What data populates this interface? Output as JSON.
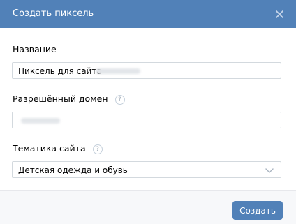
{
  "dialog": {
    "title": "Создать пиксель",
    "close_icon": "close-icon"
  },
  "form": {
    "name": {
      "label": "Название",
      "value_prefix": "Пиксель для сайта"
    },
    "domain": {
      "label": "Разрешённый домен",
      "help_icon": "?"
    },
    "topic": {
      "label": "Тематика сайта",
      "help_icon": "?",
      "selected": "Детская одежда и обувь",
      "dropdown_icon": "chevron-down-icon"
    }
  },
  "footer": {
    "create_label": "Создать"
  },
  "colors": {
    "header_bg": "#5181b8",
    "button_bg": "#5181b8",
    "footer_bg": "#f7f8fa",
    "input_border": "#d3d9de"
  }
}
